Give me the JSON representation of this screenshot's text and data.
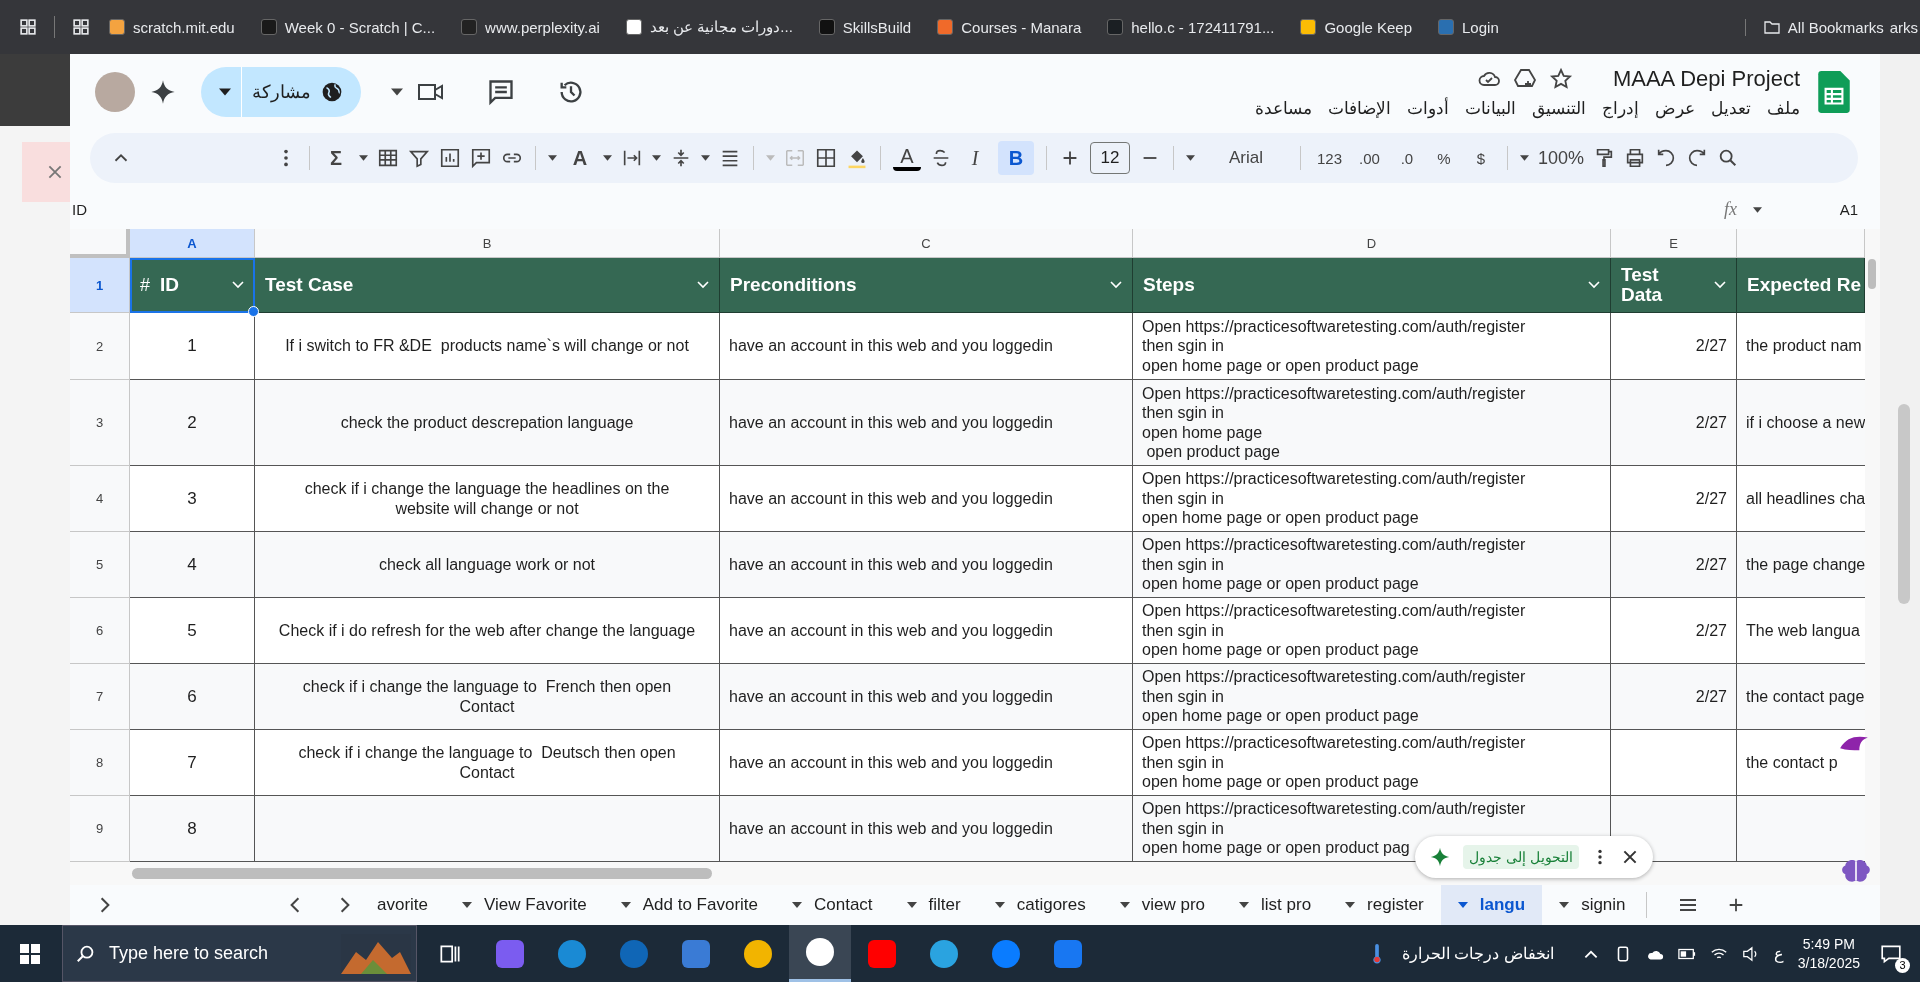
{
  "bookmarks_bar": {
    "items": [
      {
        "label": "scratch.mit.edu"
      },
      {
        "label": "Week 0 - Scratch | C..."
      },
      {
        "label": "www.perplexity.ai"
      },
      {
        "label": "دورات مجانية عن بعد..."
      },
      {
        "label": "SkillsBuild"
      },
      {
        "label": "Courses - Manara"
      },
      {
        "label": "hello.c - 172411791..."
      },
      {
        "label": "Google Keep"
      },
      {
        "label": "Login"
      }
    ],
    "all_bookmarks": "All Bookmarks",
    "overflow_text": "arks"
  },
  "document": {
    "title": "MAAA Depi Project",
    "share_label": "مشاركة",
    "menu": [
      "ملف",
      "تعديل",
      "عرض",
      "إدراج",
      "التنسيق",
      "البيانات",
      "أدوات",
      "الإضافات",
      "مساعدة"
    ]
  },
  "toolbar": {
    "sum": "Σ",
    "rotate_glyph": "A",
    "text_color_glyph": "A",
    "italic": "I",
    "bold": {
      "label": "B",
      "selected": true
    },
    "font_size": "12",
    "font": "Arial",
    "number_format": "123",
    "increase_decimals": ".00",
    "decrease_decimals": ".0",
    "percent": "%",
    "currency": "$",
    "zoom": "100%"
  },
  "formula_bar": {
    "content": "ID",
    "fx": "fx",
    "cell_ref": "A1"
  },
  "grid": {
    "column_letters": [
      {
        "label": "A",
        "selected": true
      },
      {
        "label": "B",
        "selected": false
      },
      {
        "label": "C",
        "selected": false
      },
      {
        "label": "D",
        "selected": false
      },
      {
        "label": "E",
        "selected": false
      }
    ],
    "header_row": {
      "row_number": "1",
      "selected": true,
      "id_marker": "#",
      "cells": [
        "ID",
        "Test Case",
        "Preconditions",
        "Steps",
        "Test\nData",
        "Expected Re"
      ]
    },
    "rows": [
      {
        "row_number": "2",
        "id": "1",
        "test_case": "If i switch to FR &DE  products name`s will change or not",
        "preconditions": "have an account in this web and you loggedin",
        "steps": "Open https://practicesoftwaretesting.com/auth/register\nthen sgin in\nopen home page or open product page",
        "test_data": "2/27",
        "expected": "the product nam"
      },
      {
        "row_number": "3",
        "id": "2",
        "test_case": "check the product descrepation language",
        "preconditions": "have an account in this web and you loggedin",
        "steps": "Open https://practicesoftwaretesting.com/auth/register\nthen sgin in\nopen home page\n open product page",
        "test_data": "2/27",
        "expected": "if i choose a new"
      },
      {
        "row_number": "4",
        "id": "3",
        "test_case": "check if i change the language the headlines on the website will change or not",
        "preconditions": "have an account in this web and you loggedin",
        "steps": "Open https://practicesoftwaretesting.com/auth/register\nthen sgin in\nopen home page or open product page",
        "test_data": "2/27",
        "expected": "all headlines cha"
      },
      {
        "row_number": "5",
        "id": "4",
        "test_case": "check all language work or not",
        "preconditions": "have an account in this web and you loggedin",
        "steps": "Open https://practicesoftwaretesting.com/auth/register\nthen sgin in\nopen home page or open product page",
        "test_data": "2/27",
        "expected": "the page change"
      },
      {
        "row_number": "6",
        "id": "5",
        "test_case": "Check if i do refresh for the web after change the language",
        "preconditions": "have an account in this web and you loggedin",
        "steps": "Open https://practicesoftwaretesting.com/auth/register\nthen sgin in\nopen home page or open product page",
        "test_data": "2/27",
        "expected": "The web langua"
      },
      {
        "row_number": "7",
        "id": "6",
        "test_case": "check if i change the language to  French then open Contact",
        "preconditions": "have an account in this web and you loggedin",
        "steps": "Open https://practicesoftwaretesting.com/auth/register\nthen sgin in\nopen home page or open product page",
        "test_data": "2/27",
        "expected": "the contact page"
      },
      {
        "row_number": "8",
        "id": "7",
        "test_case": "check if i change the language to  Deutsch then open Contact",
        "preconditions": "have an account in this web and you loggedin",
        "steps": "Open https://practicesoftwaretesting.com/auth/register\nthen sgin in\nopen home page or open product page",
        "test_data": "",
        "expected": "the contact p"
      },
      {
        "row_number": "9",
        "id": "8",
        "test_case": "",
        "preconditions": "have an account in this web and you loggedin",
        "steps": "Open https://practicesoftwaretesting.com/auth/register\nthen sgin in\nopen home page or open product pag",
        "test_data": "",
        "expected": ""
      }
    ]
  },
  "toast": {
    "label": "التحويل إلى جدول"
  },
  "sheet_tabs": {
    "tabs": [
      {
        "label": "avorite",
        "selected": false,
        "caret": false
      },
      {
        "label": "View Favorite",
        "selected": false,
        "caret": true
      },
      {
        "label": "Add to Favorite",
        "selected": false,
        "caret": true
      },
      {
        "label": "Contact",
        "selected": false,
        "caret": true
      },
      {
        "label": "filter",
        "selected": false,
        "caret": true
      },
      {
        "label": "catigores",
        "selected": false,
        "caret": true
      },
      {
        "label": "view pro",
        "selected": false,
        "caret": true
      },
      {
        "label": "list pro",
        "selected": false,
        "caret": true
      },
      {
        "label": "register",
        "selected": false,
        "caret": true
      },
      {
        "label": "langu",
        "selected": true,
        "caret": true
      },
      {
        "label": "signin",
        "selected": false,
        "caret": true
      }
    ]
  },
  "taskbar": {
    "search_placeholder": "Type here to search",
    "weather": "انخفاض درجات الحرارة",
    "language": "ع",
    "time": "5:49 PM",
    "date": "3/18/2025",
    "notifications": "3"
  }
}
